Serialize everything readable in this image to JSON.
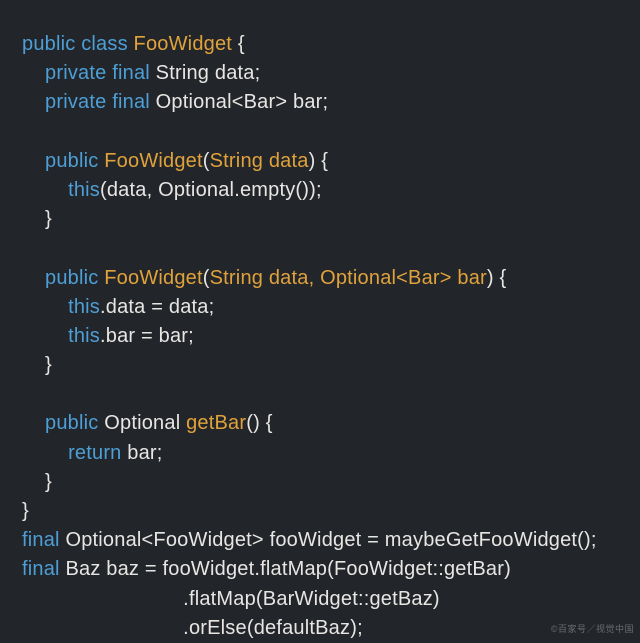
{
  "code": {
    "lines": [
      {
        "indent": 0,
        "tokens": [
          {
            "t": "public ",
            "c": "k-mod"
          },
          {
            "t": "class ",
            "c": "k-mod"
          },
          {
            "t": "FooWidget",
            "c": "k-class"
          },
          {
            "t": " {",
            "c": "k-punc"
          }
        ]
      },
      {
        "indent": 1,
        "tokens": [
          {
            "t": "private ",
            "c": "k-mod"
          },
          {
            "t": "final ",
            "c": "k-mod"
          },
          {
            "t": "String data;",
            "c": "k-type"
          }
        ]
      },
      {
        "indent": 1,
        "tokens": [
          {
            "t": "private ",
            "c": "k-mod"
          },
          {
            "t": "final ",
            "c": "k-mod"
          },
          {
            "t": "Optional<Bar> bar;",
            "c": "k-type"
          }
        ]
      },
      {
        "indent": 0,
        "tokens": [
          {
            "t": " ",
            "c": "k-punc"
          }
        ]
      },
      {
        "indent": 1,
        "tokens": [
          {
            "t": "public ",
            "c": "k-mod"
          },
          {
            "t": "FooWidget",
            "c": "k-class"
          },
          {
            "t": "(",
            "c": "k-punc"
          },
          {
            "t": "String data",
            "c": "k-param"
          },
          {
            "t": ") {",
            "c": "k-punc"
          }
        ]
      },
      {
        "indent": 2,
        "tokens": [
          {
            "t": "this",
            "c": "k-this"
          },
          {
            "t": "(data, Optional.empty());",
            "c": "k-type"
          }
        ]
      },
      {
        "indent": 1,
        "tokens": [
          {
            "t": "}",
            "c": "k-punc"
          }
        ]
      },
      {
        "indent": 0,
        "tokens": [
          {
            "t": " ",
            "c": "k-punc"
          }
        ]
      },
      {
        "indent": 1,
        "tokens": [
          {
            "t": "public ",
            "c": "k-mod"
          },
          {
            "t": "FooWidget",
            "c": "k-class"
          },
          {
            "t": "(",
            "c": "k-punc"
          },
          {
            "t": "String data, Optional<Bar> bar",
            "c": "k-param"
          },
          {
            "t": ") {",
            "c": "k-punc"
          }
        ]
      },
      {
        "indent": 2,
        "tokens": [
          {
            "t": "this",
            "c": "k-this"
          },
          {
            "t": ".data = data;",
            "c": "k-type"
          }
        ]
      },
      {
        "indent": 2,
        "tokens": [
          {
            "t": "this",
            "c": "k-this"
          },
          {
            "t": ".bar = bar;",
            "c": "k-type"
          }
        ]
      },
      {
        "indent": 1,
        "tokens": [
          {
            "t": "}",
            "c": "k-punc"
          }
        ]
      },
      {
        "indent": 0,
        "tokens": [
          {
            "t": " ",
            "c": "k-punc"
          }
        ]
      },
      {
        "indent": 1,
        "tokens": [
          {
            "t": "public ",
            "c": "k-mod"
          },
          {
            "t": "Optional ",
            "c": "k-type"
          },
          {
            "t": "getBar",
            "c": "k-class"
          },
          {
            "t": "() {",
            "c": "k-punc"
          }
        ]
      },
      {
        "indent": 2,
        "tokens": [
          {
            "t": "return ",
            "c": "k-mod"
          },
          {
            "t": "bar;",
            "c": "k-type"
          }
        ]
      },
      {
        "indent": 1,
        "tokens": [
          {
            "t": "}",
            "c": "k-punc"
          }
        ]
      },
      {
        "indent": 0,
        "tokens": [
          {
            "t": "}",
            "c": "k-punc"
          }
        ]
      },
      {
        "indent": 0,
        "tokens": [
          {
            "t": "final ",
            "c": "k-mod"
          },
          {
            "t": "Optional<FooWidget> fooWidget = maybeGetFooWidget();",
            "c": "k-type"
          }
        ]
      },
      {
        "indent": 0,
        "tokens": [
          {
            "t": "final ",
            "c": "k-mod"
          },
          {
            "t": "Baz baz = fooWidget.flatMap(FooWidget::getBar)",
            "c": "k-type"
          }
        ]
      },
      {
        "indent": 0,
        "tokens": [
          {
            "t": "                            .flatMap(BarWidget::getBaz)",
            "c": "k-type"
          }
        ]
      },
      {
        "indent": 0,
        "tokens": [
          {
            "t": "                            .orElse(defaultBaz);",
            "c": "k-type"
          }
        ]
      }
    ]
  },
  "watermark": "©百家号／视觉中国"
}
